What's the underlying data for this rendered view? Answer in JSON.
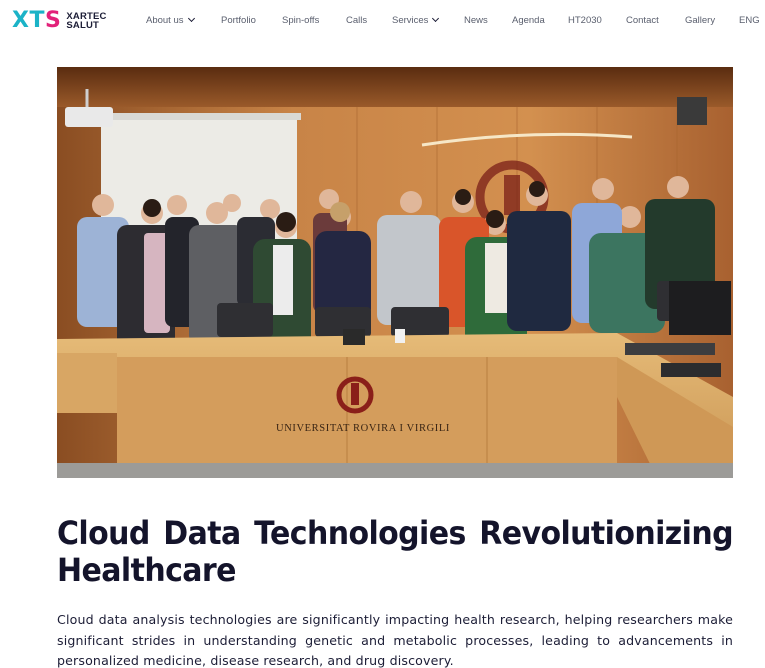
{
  "brand": {
    "mark": "XTS",
    "name_line1": "XARTEC",
    "name_line2": "SALUT"
  },
  "nav": {
    "items": [
      {
        "label": "About us",
        "has_dropdown": true
      },
      {
        "label": "Portfolio",
        "has_dropdown": false
      },
      {
        "label": "Spin-offs",
        "has_dropdown": false
      },
      {
        "label": "Calls",
        "has_dropdown": false
      },
      {
        "label": "Services",
        "has_dropdown": true
      },
      {
        "label": "News",
        "has_dropdown": false
      },
      {
        "label": "Agenda",
        "has_dropdown": false
      },
      {
        "label": "HT2030",
        "has_dropdown": false
      },
      {
        "label": "Contact",
        "has_dropdown": false
      },
      {
        "label": "Gallery",
        "has_dropdown": false
      },
      {
        "label": "ENG",
        "has_dropdown": false
      }
    ]
  },
  "hero": {
    "desk_sign": "UNIVERSITAT ROVIRA I VIRGILI"
  },
  "article": {
    "title_words": [
      "Cloud",
      "Data",
      "Technologies",
      "Revolutionizing"
    ],
    "title_line2": "Healthcare",
    "intro": "Cloud data analysis technologies are significantly impacting health research, helping researchers make significant strides in understanding genetic and metabolic processes, leading to advancements in personalized medicine, disease research, and drug discovery."
  },
  "colors": {
    "brand_teal": "#1bb3c7",
    "brand_pink": "#e2227a",
    "text_dark": "#14142b",
    "nav_text": "#5a5f6e"
  }
}
